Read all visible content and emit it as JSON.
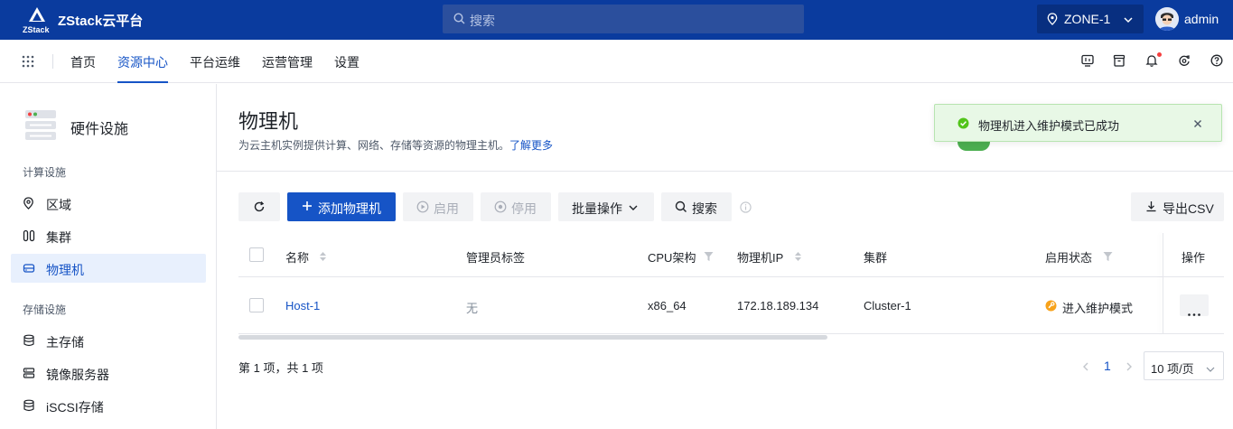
{
  "topbar": {
    "logo_text": "ZStack",
    "app_name": "ZStack云平台",
    "search_placeholder": "搜索",
    "zone": "ZONE-1",
    "user": "admin"
  },
  "nav": {
    "items": [
      "首页",
      "资源中心",
      "平台运维",
      "运营管理",
      "设置"
    ],
    "active": "资源中心"
  },
  "sidebar": {
    "title": "硬件设施",
    "sections": [
      {
        "label": "计算设施",
        "items": [
          {
            "label": "区域",
            "icon": "location-icon"
          },
          {
            "label": "集群",
            "icon": "cluster-icon"
          },
          {
            "label": "物理机",
            "icon": "host-icon",
            "active": true
          }
        ]
      },
      {
        "label": "存储设施",
        "items": [
          {
            "label": "主存储",
            "icon": "database-icon"
          },
          {
            "label": "镜像服务器",
            "icon": "server-icon"
          },
          {
            "label": "iSCSI存储",
            "icon": "storage-icon"
          }
        ]
      }
    ]
  },
  "page": {
    "title": "物理机",
    "description": "为云主机实例提供计算、网络、存储等资源的物理主机。",
    "learn_more": "了解更多"
  },
  "toolbar": {
    "add": "添加物理机",
    "enable": "启用",
    "disable": "停用",
    "batch": "批量操作",
    "search": "搜索",
    "export": "导出CSV"
  },
  "table": {
    "columns": [
      "名称",
      "管理员标签",
      "CPU架构",
      "物理机IP",
      "集群",
      "启用状态",
      "操作"
    ],
    "rows": [
      {
        "name": "Host-1",
        "admin_tag": "无",
        "cpu_arch": "x86_64",
        "ip": "172.18.189.134",
        "cluster": "Cluster-1",
        "status": "进入维护模式"
      }
    ]
  },
  "pagination": {
    "info": "第 1 项，共 1 项",
    "current_page": "1",
    "page_size": "10 项/页"
  },
  "toast": {
    "message": "物理机进入维护模式已成功"
  },
  "colors": {
    "topbar": "#0a3b9e",
    "primary": "#1654c6",
    "success": "#52c41a",
    "warning": "#f7a21b"
  }
}
